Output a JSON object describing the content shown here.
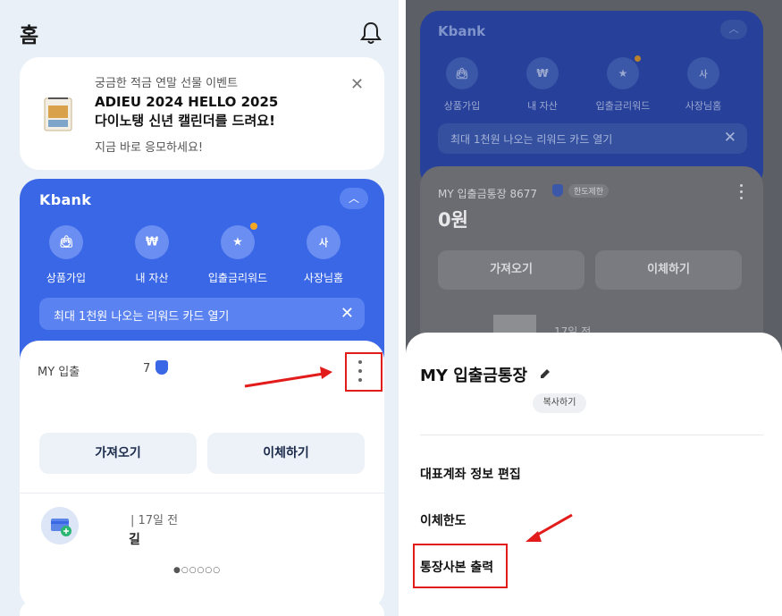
{
  "left": {
    "header": {
      "title": "홈"
    },
    "event_card": {
      "subtitle": "궁금한 적금 연말 선물 이벤트",
      "title": "ADIEU 2024 HELLO 2025\n다이노탱 신년 캘린더를 드려요!",
      "footer": "지금 바로 응모하세요!"
    },
    "kbank": {
      "logo": "Kbank",
      "quick_actions": [
        {
          "label": "상품가입",
          "glyph": "bag-icon"
        },
        {
          "label": "내 자산",
          "glyph": "won-icon"
        },
        {
          "label": "입출금리워드",
          "glyph": "star-card-icon"
        },
        {
          "label": "사장님홈",
          "glyph": "home-sa-icon"
        }
      ],
      "reward_banner": "최대 1천원 나오는 리워드 카드 열기"
    },
    "account": {
      "name": "MY 입출",
      "number": "7",
      "buttons": {
        "fetch": "가져오기",
        "transfer": "이체하기"
      },
      "transaction": {
        "time": "| 17일 전",
        "desc": "길"
      },
      "pager": "●○○○○○"
    }
  },
  "right": {
    "kbank": {
      "logo": "Kbank",
      "quick_actions": [
        {
          "label": "상품가입"
        },
        {
          "label": "내 자산"
        },
        {
          "label": "입출금리워드"
        },
        {
          "label": "사장님홈"
        }
      ],
      "reward_banner": "최대 1천원 나오는 리워드 카드 열기"
    },
    "account": {
      "name": "MY 입출금통장 8677",
      "tag": "한도제한",
      "balance": "0원",
      "buttons": {
        "fetch": "가져오기",
        "transfer": "이체하기"
      },
      "transaction_time": "17일 전"
    },
    "sheet": {
      "title": "MY 입출금통장",
      "copy_label": "복사하기",
      "menu": [
        "대표계좌 정보 편집",
        "이체한도",
        "통장사본 출력"
      ]
    }
  },
  "colors": {
    "kbank_blue": "#3a67e6",
    "highlight_red": "#e21b1b",
    "dot_orange": "#f5a623"
  }
}
